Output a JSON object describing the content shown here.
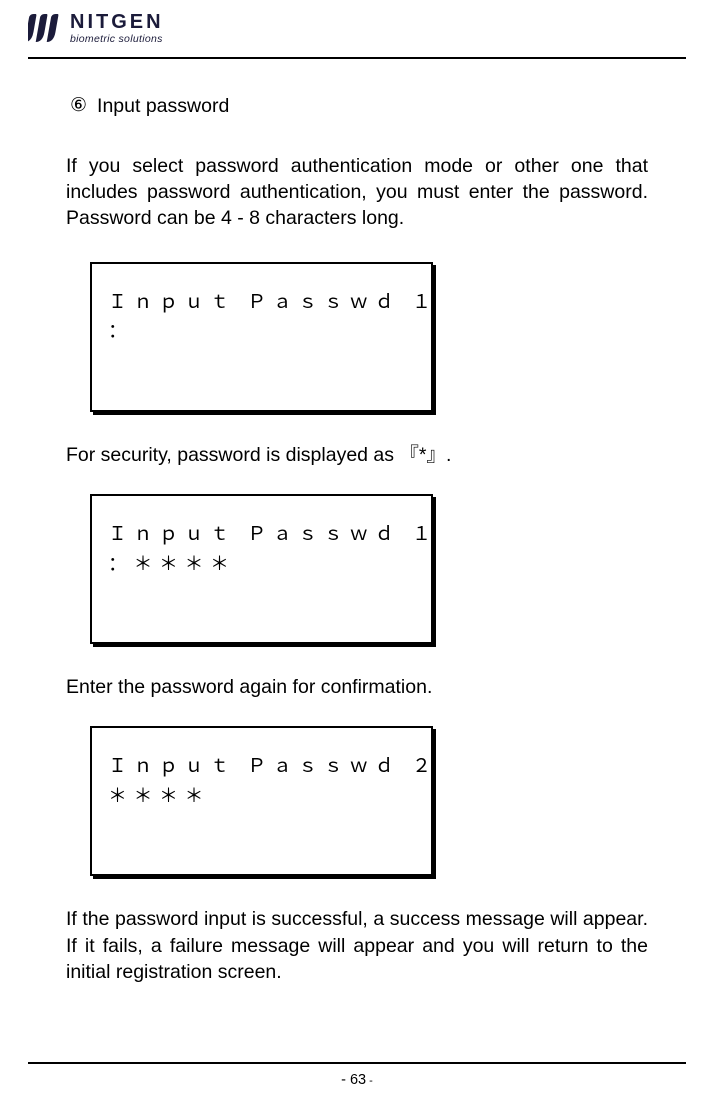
{
  "brand": {
    "name": "NITGEN",
    "tagline": "biometric solutions"
  },
  "step": {
    "marker": "⑥",
    "title": "Input password"
  },
  "para1": "If you select password authentication mode or other one that includes password authentication, you must enter the password. Password can be 4 - 8 characters long.",
  "lcd1": {
    "line1": "Ｉｎｐｕｔ Ｐａｓｓｗｄ １",
    "line2": "："
  },
  "para2": "For security, password is displayed as  『*』.",
  "lcd2": {
    "line1": "Ｉｎｐｕｔ Ｐａｓｓｗｄ １",
    "line2": "：＊＊＊＊"
  },
  "para3": "Enter the password again for confirmation.",
  "lcd3": {
    "line1": "Ｉｎｐｕｔ Ｐａｓｓｗｄ ２",
    "line2": "＊＊＊＊"
  },
  "para4": "If the password input is successful, a success message will appear. If it fails, a failure message will appear and you will return to the initial registration screen.",
  "footer": {
    "dash1": "- ",
    "page": "63",
    "dash2": " -"
  }
}
